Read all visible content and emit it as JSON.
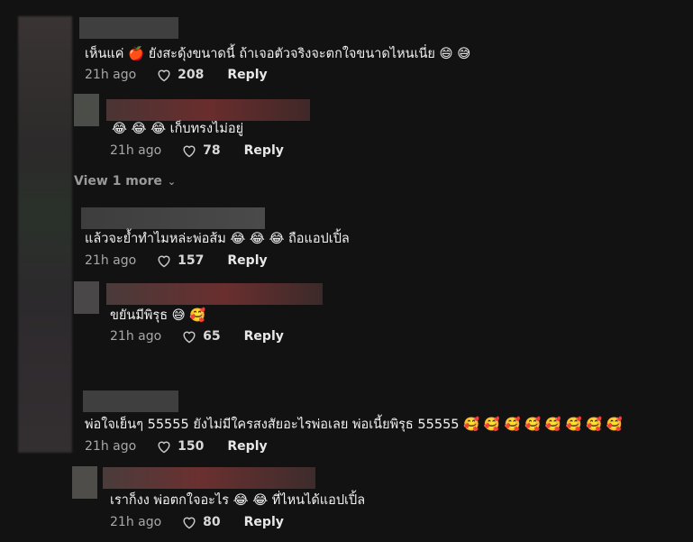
{
  "comments": [
    {
      "text": "เห็นแค่ 🍎 ยังสะดุ้งขนาดนี้ ถ้าเจอตัวจริงจะตกใจขนาดไหนเนี่ย 😄 😅",
      "time": "21h ago",
      "likes": "208",
      "reply": "Reply"
    },
    {
      "text": "😂 😂 😂 เก็บทรงไม่อยู่",
      "time": "21h ago",
      "likes": "78",
      "reply": "Reply"
    },
    {
      "text": "แล้วจะย้ำทำไมหล่ะพ่อส้ม 😂 😂 😂 ถือแอปเปิ้ล",
      "time": "21h ago",
      "likes": "157",
      "reply": "Reply"
    },
    {
      "text": "ขยันมีพิรุธ 😅 🥰",
      "time": "21h ago",
      "likes": "65",
      "reply": "Reply"
    },
    {
      "text": "พ่อใจเย็นๆ 55555 ยังไม่มีใครสงสัยอะไรพ่อเลย พ่อเนี้ยพิรุธ 55555 🥰 🥰 🥰 🥰 🥰 🥰 🥰 🥰",
      "time": "21h ago",
      "likes": "150",
      "reply": "Reply"
    },
    {
      "text": "เราก็งง พ่อตกใจอะไร 😂 😂  ที่ไหนได้แอปเปิ้ล",
      "time": "21h ago",
      "likes": "80",
      "reply": "Reply"
    }
  ],
  "view_more": "View 1 more"
}
